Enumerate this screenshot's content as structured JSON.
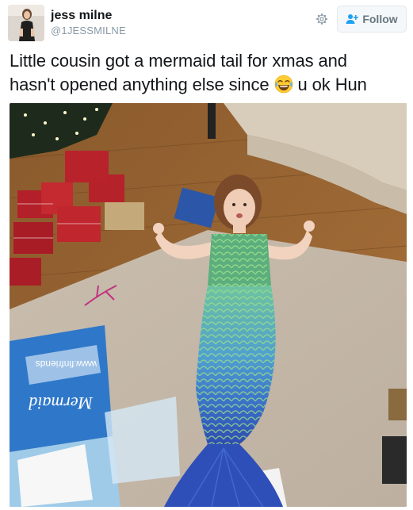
{
  "tweet": {
    "display_name": "jess milne",
    "handle": "@1JESSMILNE",
    "text_line1": "Little cousin got a mermaid tail for xmas and",
    "text_line2_before": "hasn't opened anything else since",
    "text_line2_after": "u ok Hun",
    "emoji": "face-with-tears-of-joy"
  },
  "actions": {
    "follow_label": "Follow",
    "settings_icon": "gear-icon",
    "follow_icon": "add-user-icon"
  },
  "media": {
    "box_text": "www.finfriends",
    "box_brand": "Mermaid"
  },
  "colors": {
    "follow_bg": "#f5f8fa",
    "follow_text": "#66757f",
    "follow_icon": "#1da1f2",
    "handle": "#8899a6"
  }
}
